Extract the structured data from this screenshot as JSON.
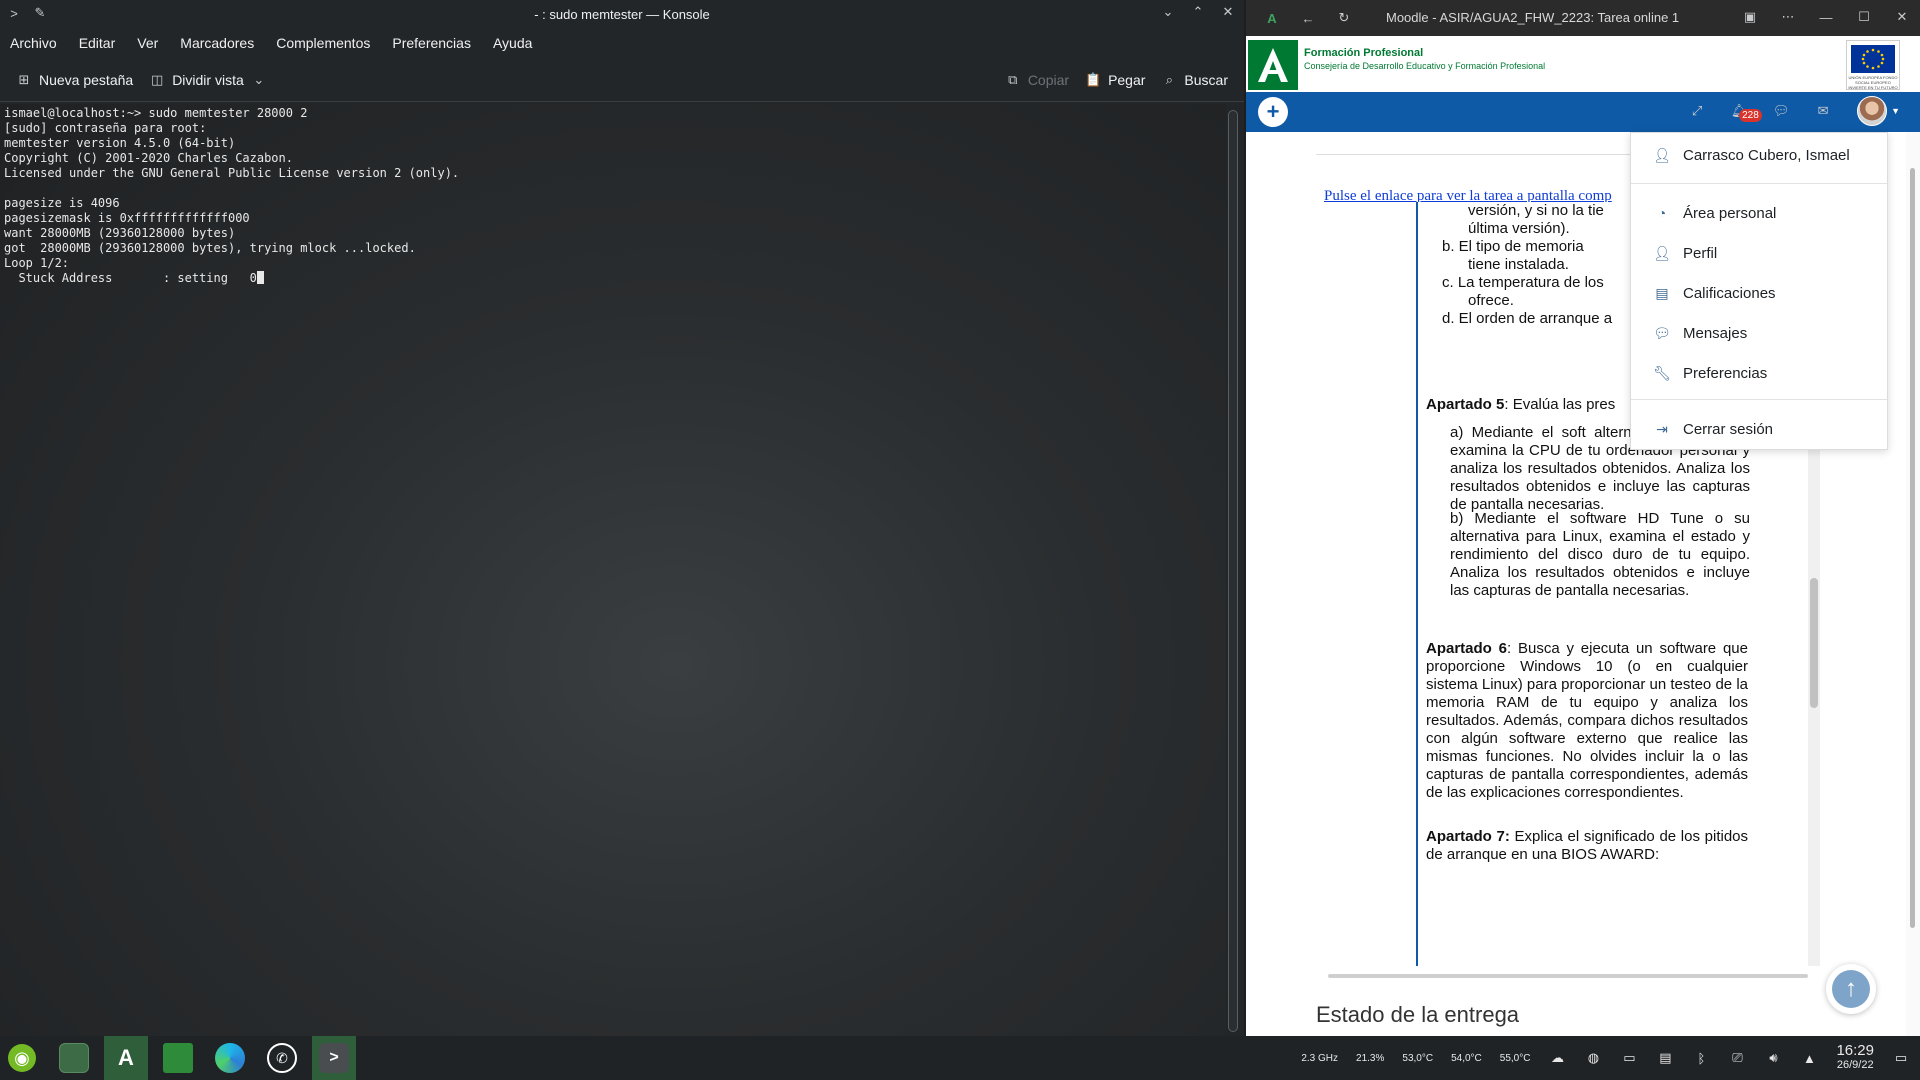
{
  "konsole": {
    "title": "- : sudo memtester — Konsole",
    "menu": [
      "Archivo",
      "Editar",
      "Ver",
      "Marcadores",
      "Complementos",
      "Preferencias",
      "Ayuda"
    ],
    "toolbar": {
      "new_tab": "Nueva pestaña",
      "split_view": "Dividir vista",
      "copy": "Copiar",
      "paste": "Pegar",
      "find": "Buscar"
    },
    "terminal_lines": [
      "ismael@localhost:~> sudo memtester 28000 2",
      "[sudo] contraseña para root:",
      "memtester version 4.5.0 (64-bit)",
      "Copyright (C) 2001-2020 Charles Cazabon.",
      "Licensed under the GNU General Public License version 2 (only).",
      "",
      "pagesize is 4096",
      "pagesizemask is 0xfffffffffffff000",
      "want 28000MB (29360128000 bytes)",
      "got  28000MB (29360128000 bytes), trying mlock ...locked.",
      "Loop 1/2:",
      "  Stuck Address       : setting   0"
    ]
  },
  "edge": {
    "title": "Moodle - ASIR/AGUA2_FHW_2223: Tarea online 1"
  },
  "moodle": {
    "brand_line1": "Formación Profesional",
    "brand_line2": "Consejería de Desarrollo Educativo y Formación Profesional",
    "eu_text": "UNIÓN EUROPEA FONDO SOCIAL EUROPEO INVIERTE EN TU FUTURO",
    "notif_count": "228",
    "link_text": "Pulse el enlace para ver la tarea a pantalla comp",
    "doc": {
      "list_top": [
        "versión, y si no la tie",
        "última versión).",
        "b. El tipo de memoria",
        "tiene instalada.",
        "c. La temperatura de los",
        "ofrece.",
        "d. El orden de arranque a"
      ],
      "ap5_label": "Apartado 5",
      "ap5_text": ": Evalúa las pres",
      "ap5a": "a) Mediante el soft alternativa para Linux, examina la CPU de tu ordenador personal y analiza los resultados obtenidos. Analiza los resultados obtenidos e incluye las capturas de pantalla necesarias.",
      "ap5b": "b) Mediante el software HD Tune o su alternativa para Linux, examina el estado y rendimiento del disco duro de tu equipo. Analiza los resultados obtenidos e incluye las capturas de pantalla necesarias.",
      "ap6_label": "Apartado 6",
      "ap6_text": ": Busca y ejecuta un software que proporcione Windows 10 (o en cualquier sistema Linux) para proporcionar un testeo de la memoria RAM de tu equipo y analiza los resultados. Además, compara dichos resultados con algún software externo que realice las mismas funciones. No olvides incluir la o las capturas de pantalla correspondientes, además de las explicaciones correspondientes.",
      "ap7_label": "Apartado 7:",
      "ap7_text": " Explica el significado de los pitidos de arranque en una BIOS AWARD:"
    },
    "estado": "Estado de la entrega",
    "dropdown": {
      "user": "Carrasco Cubero, Ismael",
      "items": [
        "Área personal",
        "Perfil",
        "Calificaciones",
        "Mensajes",
        "Preferencias"
      ],
      "logout": "Cerrar sesión"
    }
  },
  "tray": {
    "cpu_freq": "2.3 GHz",
    "cpu_load": "21.3%",
    "temp1": "53,0°C",
    "temp2": "54,0°C",
    "temp3": "55,0°C",
    "time": "16:29",
    "date": "26/9/22"
  },
  "colors": {
    "moodle_nav": "#0f5aa6",
    "junta_green": "#007a33",
    "konsole_bg": "#232629",
    "taskbar_bg": "#202326"
  }
}
